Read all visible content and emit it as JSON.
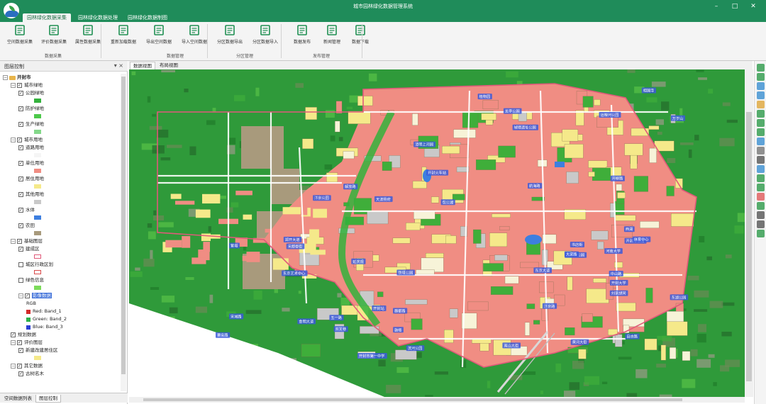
{
  "app": {
    "title": "城市园林绿化数据管理系统"
  },
  "window_controls": [
    "–",
    "□",
    "✕"
  ],
  "ribbon": {
    "tabs": [
      "园林绿化数据采集",
      "园林绿化数据处理",
      "园林绿化数据制图"
    ],
    "buttons": [
      {
        "label": "空间数据采集",
        "icon": "layers-icon"
      },
      {
        "label": "评价数据采集",
        "icon": "table-icon"
      },
      {
        "label": "属性数据采集",
        "icon": "document-edit-icon"
      },
      {
        "label": "重新加载数据",
        "icon": "refresh-icon"
      },
      {
        "label": "导出空间数据",
        "icon": "export-icon"
      },
      {
        "label": "导入空间数据",
        "icon": "import-icon"
      },
      {
        "label": "分区数据导出",
        "icon": "partition-export-icon"
      },
      {
        "label": "分区数据导入",
        "icon": "partition-import-icon"
      },
      {
        "label": "数据发布",
        "icon": "publish-icon"
      },
      {
        "label": "新闻管理",
        "icon": "news-icon"
      },
      {
        "label": "数据下载",
        "icon": "download-icon"
      }
    ],
    "groups": [
      "数据采集",
      "数据管理",
      "分区管理",
      "发布管理"
    ]
  },
  "left_panel": {
    "title": "图层控制",
    "pin": "▾ ×",
    "tree": [
      {
        "label": "开封市",
        "level": 0,
        "type": "root"
      },
      {
        "label": "城市绿地",
        "level": 1,
        "type": "group"
      },
      {
        "label": "公园绿地",
        "level": 2,
        "type": "layer",
        "swatch": "#33b13c"
      },
      {
        "label": "防护绿地",
        "level": 2,
        "type": "layer",
        "swatch": "#4cc94a"
      },
      {
        "label": "生产绿地",
        "level": 2,
        "type": "layer",
        "swatch": "#84d88a"
      },
      {
        "label": "城市用地",
        "level": 1,
        "type": "group"
      },
      {
        "label": "道路用地",
        "level": 2,
        "type": "layer",
        "swatch": "#f5f5f5"
      },
      {
        "label": "单位用地",
        "level": 2,
        "type": "layer",
        "swatch": "#f08d83"
      },
      {
        "label": "居住用地",
        "level": 2,
        "type": "layer",
        "swatch": "#f5e98a"
      },
      {
        "label": "其他用地",
        "level": 2,
        "type": "layer",
        "swatch": "#c9c9c9"
      },
      {
        "label": "水体",
        "level": 2,
        "type": "layer",
        "swatch": "#3d7fe0"
      },
      {
        "label": "农田",
        "level": 2,
        "type": "layer",
        "swatch": "#a89a7c"
      },
      {
        "label": "基础图层",
        "level": 1,
        "type": "group"
      },
      {
        "label": "建成区",
        "level": 2,
        "type": "layer",
        "swatch": "#e05a7a",
        "outline": true
      },
      {
        "label": "城区行政区划",
        "level": 2,
        "type": "layer",
        "checked": false,
        "swatch": "#d94b4b",
        "outline": true
      },
      {
        "label": "绿色信息",
        "level": 2,
        "type": "layer",
        "checked": false,
        "swatch": "#7cdb5a"
      },
      {
        "label": "影像数据",
        "level": 2,
        "type": "layer",
        "highlight": true
      },
      {
        "label": "RGB",
        "level": 3,
        "type": "text"
      },
      {
        "label": "Red: Band_1",
        "level": 3,
        "type": "band",
        "swatch": "#d42a2a"
      },
      {
        "label": "Green: Band_2",
        "level": 3,
        "type": "band",
        "swatch": "#2bb24a"
      },
      {
        "label": "Blue: Band_3",
        "level": 3,
        "type": "band",
        "swatch": "#2a3fd4"
      },
      {
        "label": "规划数据",
        "level": 1,
        "type": "group-leaf"
      },
      {
        "label": "评价图层",
        "level": 1,
        "type": "group"
      },
      {
        "label": "新建改建居住区",
        "level": 2,
        "type": "layer",
        "swatch": "#f5e98a"
      },
      {
        "label": "其它数据",
        "level": 1,
        "type": "group"
      },
      {
        "label": "古树名木",
        "level": 2,
        "type": "layer"
      }
    ],
    "tabs": [
      "空间数据列表",
      "图层控制"
    ]
  },
  "map_view": {
    "tabs": [
      "数据视图",
      "布局视图"
    ]
  },
  "map_labels": [
    "东京大道",
    "金明大道",
    "宋城路",
    "黄河大街",
    "夷山大街",
    "汴京路",
    "开封市第一中学",
    "开封火车站",
    "龙亭公园",
    "清明上河园",
    "铁塔公园",
    "汴京公园",
    "包公湖",
    "西湖",
    "开封大学",
    "河南大学",
    "万岁山",
    "东京艺术中心",
    "禹王台公园",
    "大梁路",
    "中山路",
    "解放路",
    "自由路",
    "晋安路",
    "五一路",
    "魏都路",
    "航海路",
    "开柳路",
    "郑开大道",
    "滨河公园",
    "开封博物馆",
    "体育中心",
    "运粮河公园",
    "东湖公园",
    "植物园",
    "刘家胡同",
    "开封站",
    "宋都御街",
    "城墙遗址公园",
    "鼓楼",
    "书店街",
    "双龙巷",
    "延庆观",
    "相国寺",
    "繁塔",
    "天波杨府"
  ],
  "colors": {
    "brand": "#1f8c5a",
    "vegetation": "#2f9a3a",
    "residential": "#f5e98a",
    "institutional": "#f08d83",
    "farmland": "#a89a7c",
    "water": "#3d7fe0",
    "boundary": "#e05a7a"
  }
}
